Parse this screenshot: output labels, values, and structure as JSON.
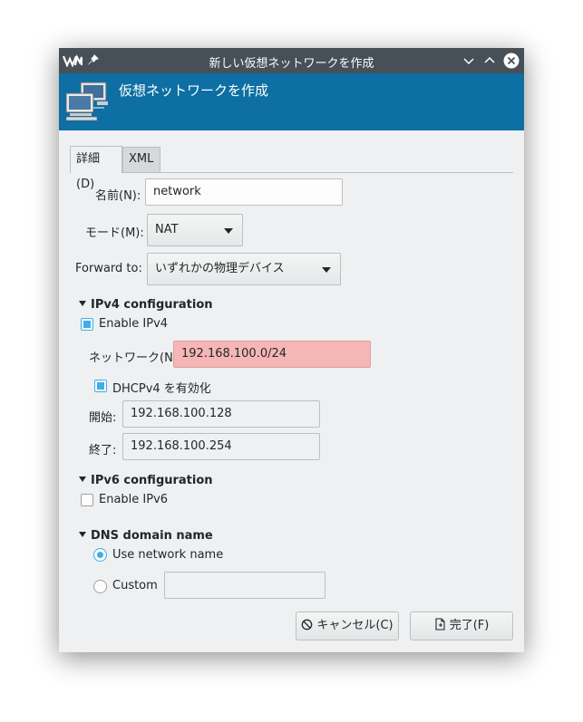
{
  "window": {
    "title": "新しい仮想ネットワークを作成",
    "header_title": "仮想ネットワークを作成"
  },
  "tabs": [
    {
      "label": "詳細(D)",
      "active": true
    },
    {
      "label": "XML",
      "active": false
    }
  ],
  "form": {
    "name_label": "名前(N):",
    "name_value": "network",
    "mode_label": "モード(M):",
    "mode_value": "NAT",
    "forward_label": "Forward to:",
    "forward_value": "いずれかの物理デバイス"
  },
  "ipv4": {
    "section_title": "IPv4 configuration",
    "enable_label": "Enable IPv4",
    "enabled": true,
    "network_label": "ネットワーク(N):",
    "network_value": "192.168.100.0/24",
    "dhcp_label": "DHCPv4 を有効化",
    "dhcp_enabled": true,
    "start_label": "開始:",
    "start_value": "192.168.100.128",
    "end_label": "終了:",
    "end_value": "192.168.100.254"
  },
  "ipv6": {
    "section_title": "IPv6 configuration",
    "enable_label": "Enable IPv6",
    "enabled": false
  },
  "dns": {
    "section_title": "DNS domain name",
    "use_network_name_label": "Use network name",
    "use_network_name_selected": true,
    "custom_label": "Custom",
    "custom_value": ""
  },
  "buttons": {
    "cancel_label": "キャンセル(C)",
    "finish_label": "完了(F)"
  },
  "colors": {
    "titlebar": "#475057",
    "header": "#0d6fa3",
    "accent": "#3daee9",
    "error_field": "#f7b6b6"
  },
  "icons": [
    "virt-manager-logo-icon",
    "pin-icon",
    "chevron-down-icon",
    "chevron-up-icon",
    "close-icon",
    "network-icon",
    "cancel-icon",
    "finish-icon"
  ]
}
